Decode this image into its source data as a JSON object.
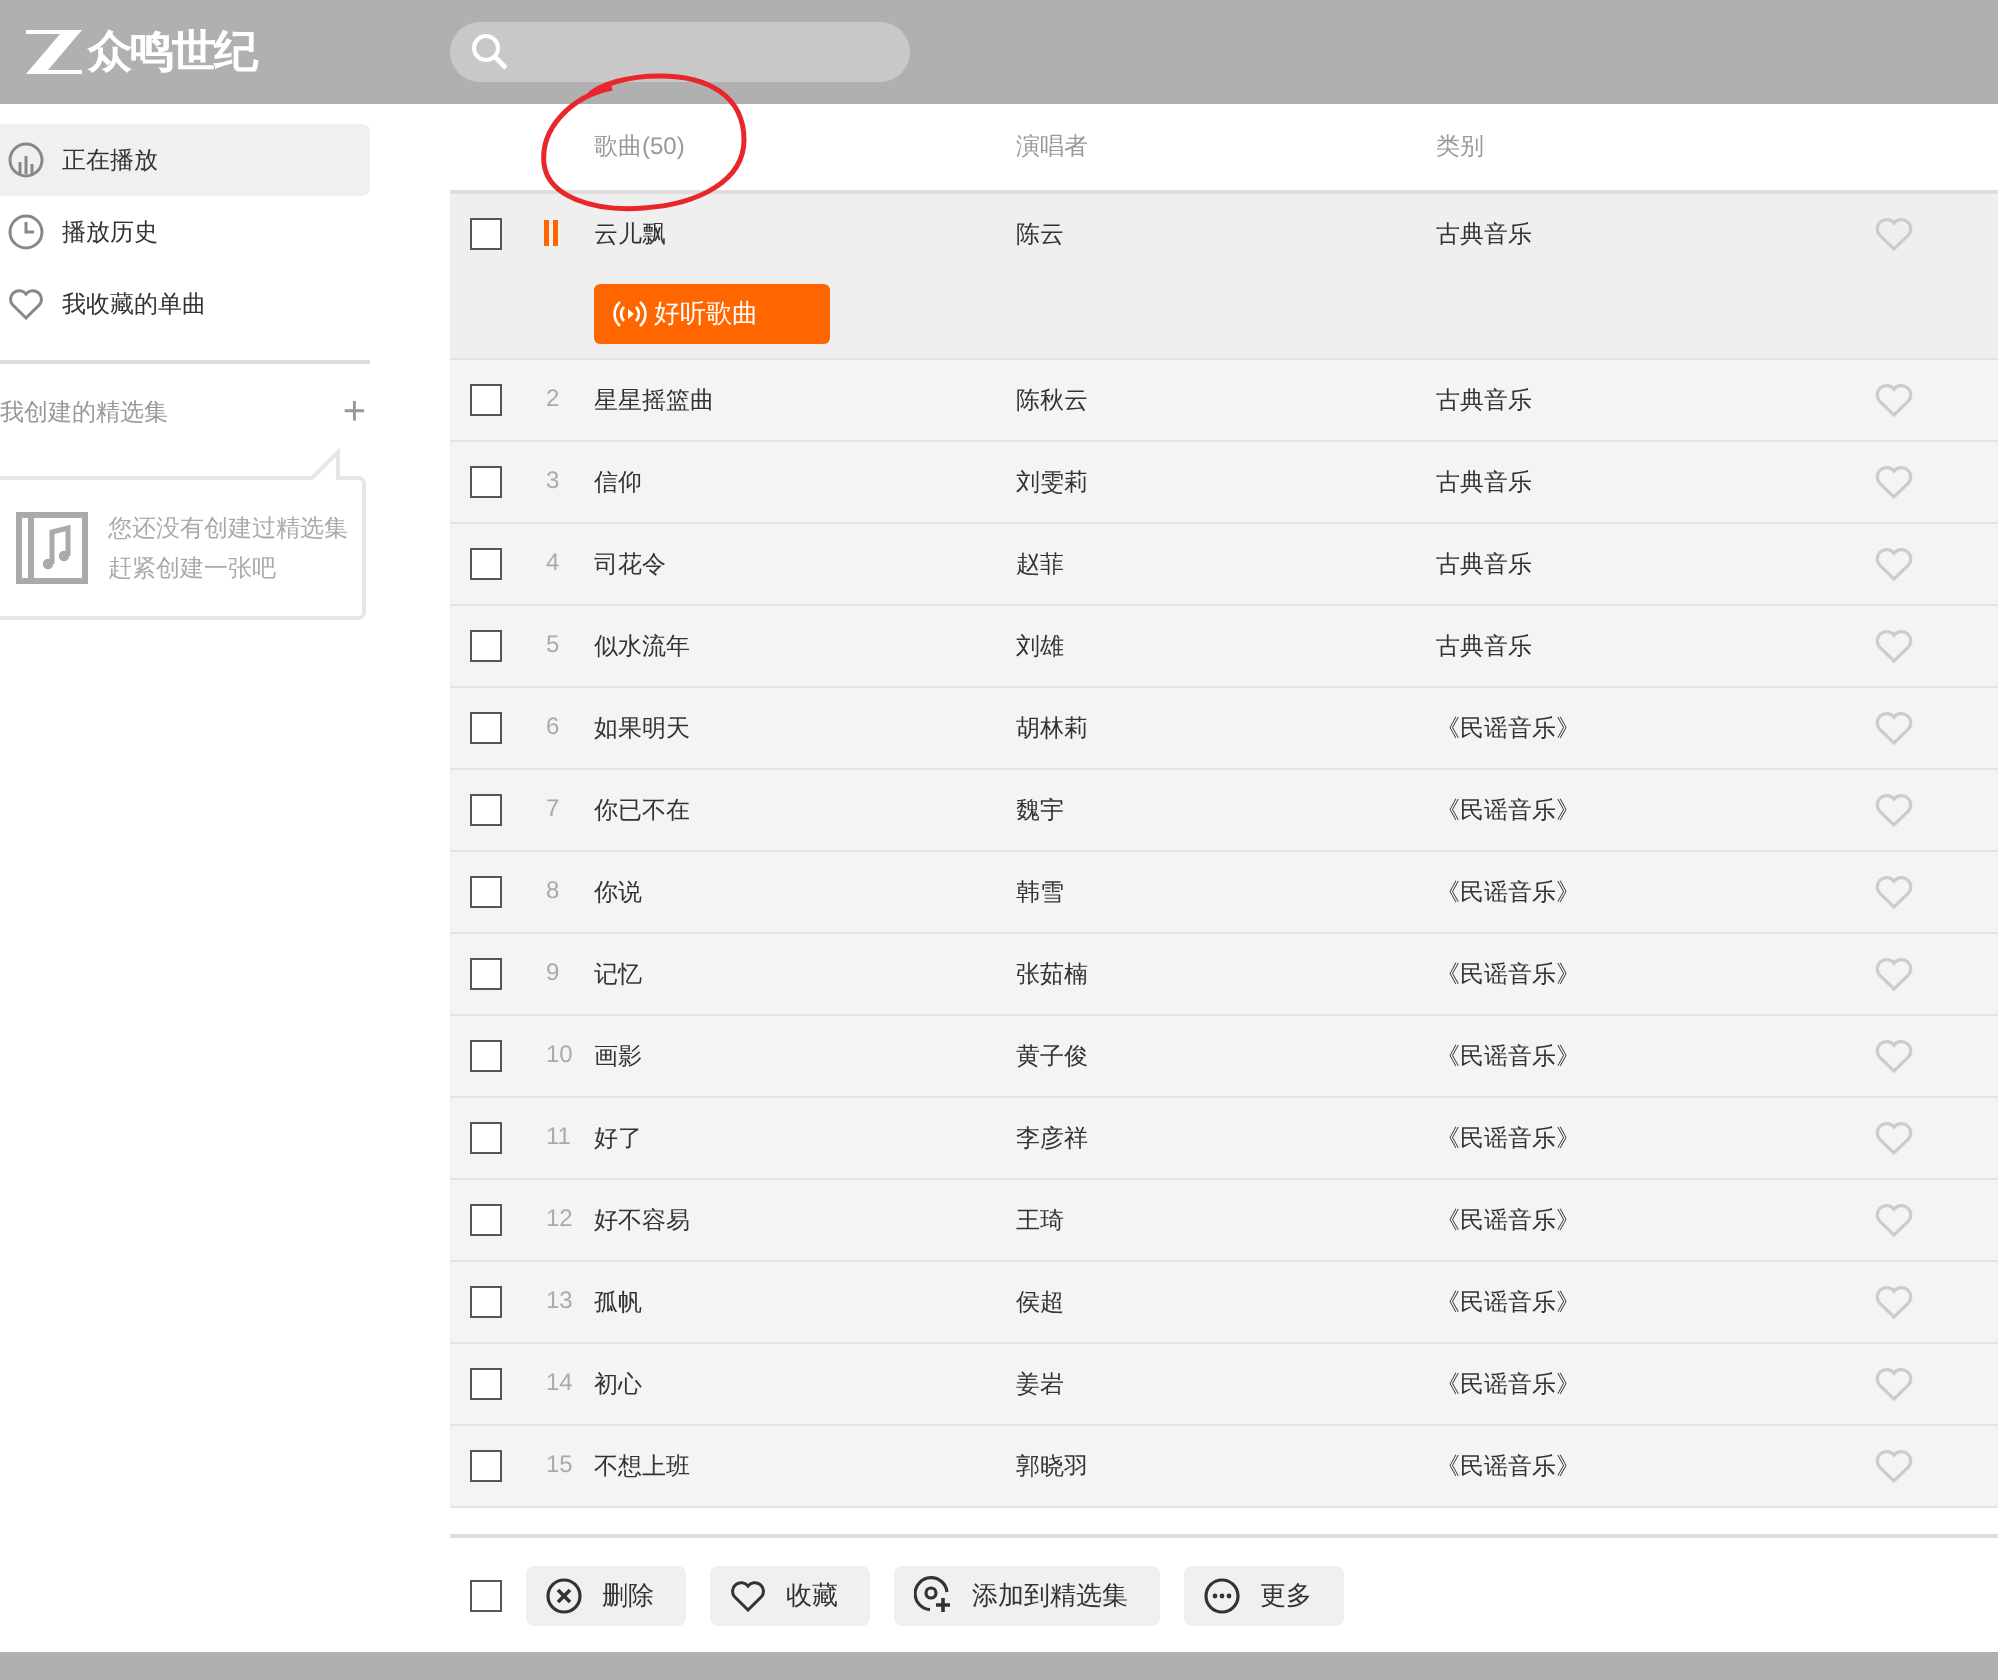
{
  "header": {
    "logo": "众鸣世纪"
  },
  "sidebar": {
    "items": [
      {
        "label": "正在播放",
        "kind": "playing",
        "selected": true
      },
      {
        "label": "播放历史",
        "kind": "history",
        "selected": false
      },
      {
        "label": "我收藏的单曲",
        "kind": "heart",
        "selected": false
      }
    ],
    "section_title": "我创建的精选集",
    "add_symbol": "+",
    "empty_text": [
      "您还没有创建过精选集",
      "赶紧创建一张吧"
    ]
  },
  "table": {
    "columns": [
      "歌曲(50)",
      "演唱者",
      "类别"
    ],
    "rows": [
      {
        "title": "云儿飘",
        "artist": "陈云",
        "category": "古典音乐",
        "playing": true,
        "selected": true,
        "checked": false,
        "favorite": false,
        "tag": "好听歌曲"
      },
      {
        "number": "2",
        "title": "星星摇篮曲",
        "artist": "陈秋云",
        "category": "古典音乐",
        "playing": false,
        "selected": false,
        "checked": false,
        "favorite": false
      },
      {
        "number": "3",
        "title": "信仰",
        "artist": "刘雯莉",
        "category": "古典音乐",
        "playing": false,
        "selected": false,
        "checked": false,
        "favorite": false
      },
      {
        "number": "4",
        "title": "司花令",
        "artist": "赵菲",
        "category": "古典音乐",
        "playing": false,
        "selected": false,
        "checked": false,
        "favorite": false
      },
      {
        "number": "5",
        "title": "似水流年",
        "artist": "刘雄",
        "category": "古典音乐",
        "playing": false,
        "selected": false,
        "checked": false,
        "favorite": false
      },
      {
        "number": "6",
        "title": "如果明天",
        "artist": "胡林莉",
        "category": "《民谣音乐》",
        "playing": false,
        "selected": false,
        "checked": false,
        "favorite": false
      },
      {
        "number": "7",
        "title": "你已不在",
        "artist": "魏宇",
        "category": "《民谣音乐》",
        "playing": false,
        "selected": false,
        "checked": false,
        "favorite": false
      },
      {
        "number": "8",
        "title": "你说",
        "artist": "韩雪",
        "category": "《民谣音乐》",
        "playing": false,
        "selected": false,
        "checked": false,
        "favorite": false
      },
      {
        "number": "9",
        "title": "记忆",
        "artist": "张茹楠",
        "category": "《民谣音乐》",
        "playing": false,
        "selected": false,
        "checked": false,
        "favorite": false
      },
      {
        "number": "10",
        "title": "画影",
        "artist": "黄子俊",
        "category": "《民谣音乐》",
        "playing": false,
        "selected": false,
        "checked": false,
        "favorite": false
      },
      {
        "number": "11",
        "title": "好了",
        "artist": "李彦祥",
        "category": "《民谣音乐》",
        "playing": false,
        "selected": false,
        "checked": false,
        "favorite": false
      },
      {
        "number": "12",
        "title": "好不容易",
        "artist": "王琦",
        "category": "《民谣音乐》",
        "playing": false,
        "selected": false,
        "checked": false,
        "favorite": false
      },
      {
        "number": "13",
        "title": "孤帆",
        "artist": "侯超",
        "category": "《民谣音乐》",
        "playing": false,
        "selected": false,
        "checked": false,
        "favorite": false
      },
      {
        "number": "14",
        "title": "初心",
        "artist": "姜岩",
        "category": "《民谣音乐》",
        "playing": false,
        "selected": false,
        "checked": false,
        "favorite": false
      },
      {
        "number": "15",
        "title": "不想上班",
        "artist": "郭晓羽",
        "category": "《民谣音乐》",
        "playing": false,
        "selected": false,
        "checked": false,
        "favorite": false
      }
    ]
  },
  "bottom_bar": {
    "select_all_checked": false,
    "buttons": [
      {
        "label": "删除",
        "kind": "delete"
      },
      {
        "label": "收藏",
        "kind": "heart"
      },
      {
        "label": "添加到精选集",
        "kind": "add"
      },
      {
        "label": "更多",
        "kind": "more"
      }
    ]
  },
  "annotation": {
    "kind": "circle",
    "color": "#e8262b"
  }
}
